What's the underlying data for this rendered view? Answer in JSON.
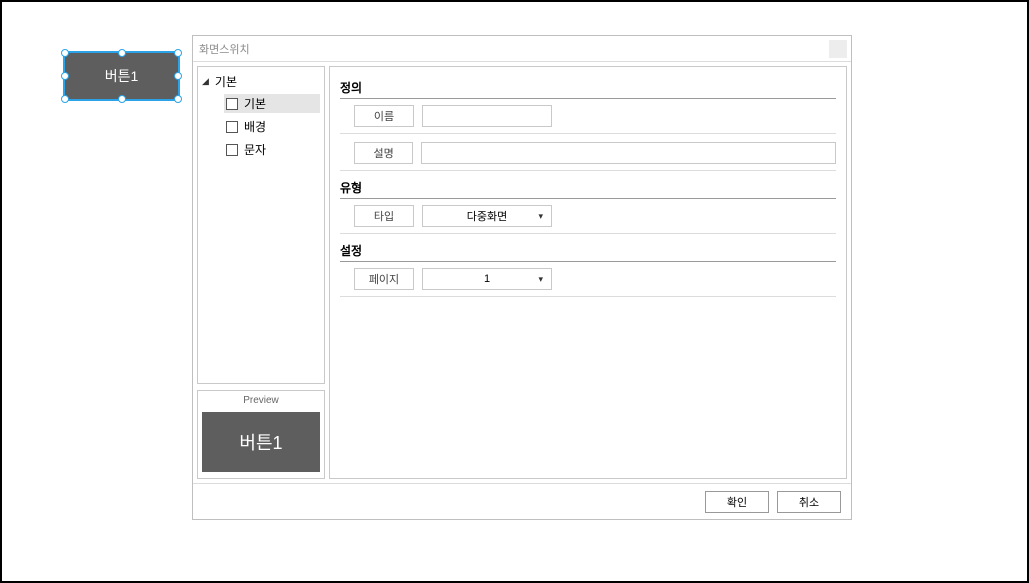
{
  "canvas": {
    "button_label": "버튼1"
  },
  "dialog": {
    "title": "화면스위치",
    "tree": {
      "root_label": "기본",
      "items": [
        {
          "label": "기본",
          "selected": true
        },
        {
          "label": "배경",
          "selected": false
        },
        {
          "label": "문자",
          "selected": false
        }
      ]
    },
    "preview": {
      "title": "Preview",
      "label": "버튼1"
    },
    "sections": {
      "definition": {
        "title": "정의",
        "name_label": "이름",
        "name_value": "",
        "desc_label": "설명",
        "desc_value": ""
      },
      "type_section": {
        "title": "유형",
        "type_label": "타입",
        "type_value": "다중화면"
      },
      "settings": {
        "title": "설정",
        "page_label": "페이지",
        "page_value": "1"
      }
    },
    "footer": {
      "ok": "확인",
      "cancel": "취소"
    }
  }
}
